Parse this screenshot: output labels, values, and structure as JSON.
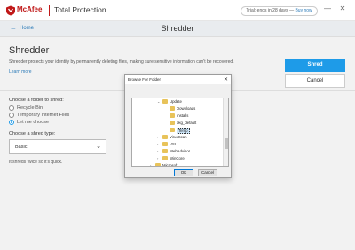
{
  "app": {
    "brand": "McAfee",
    "product": "Total Protection",
    "trial_text": "Trial: ends in 28 days — ",
    "buy_now": "Buy now",
    "window_controls": {
      "minimize": "—",
      "close": "✕"
    }
  },
  "nav": {
    "back_icon": "back-arrow-icon",
    "home_label": "Home",
    "page_title": "Shredder"
  },
  "main": {
    "heading": "Shredder",
    "description": "Shredder protects your identity by permanently deleting files, making sure sensitive information can't be recovered.",
    "learn_more": "Learn more",
    "shred_label": "Shred",
    "cancel_label": "Cancel",
    "folder_label": "Choose a folder to shred:",
    "folder_options": [
      {
        "label": "Recycle Bin",
        "checked": false
      },
      {
        "label": "Temporary Internet Files",
        "checked": false
      },
      {
        "label": "Let me choose",
        "checked": true
      }
    ],
    "shred_type_label": "Choose a shred type:",
    "shred_type_value": "Basic",
    "hint": "It shreds twice so it's quick."
  },
  "dialog": {
    "title": "Browse For Folder",
    "tree": [
      {
        "label": "Update",
        "arrow": "⌄",
        "indent": 0
      },
      {
        "label": "Downloads",
        "arrow": "",
        "indent": 1
      },
      {
        "label": "Installs",
        "arrow": "",
        "indent": 1
      },
      {
        "label": "pkg_default",
        "arrow": "",
        "indent": 1
      },
      {
        "label": "Temp",
        "arrow": "",
        "indent": 1,
        "selected": true
      },
      {
        "label": "VirusScan",
        "arrow": "›",
        "indent": 0
      },
      {
        "label": "VSL",
        "arrow": "›",
        "indent": 0
      },
      {
        "label": "WebAdvisor",
        "arrow": "›",
        "indent": 0
      },
      {
        "label": "WinCore",
        "arrow": "›",
        "indent": 0
      },
      {
        "label": "Microsoft",
        "arrow": "›",
        "indent": -1
      }
    ],
    "ok_label": "OK",
    "cancel_label": "Cancel"
  },
  "colors": {
    "brand_red": "#c01818",
    "accent_blue": "#1e9be8",
    "folder_yellow": "#e8c35a"
  }
}
